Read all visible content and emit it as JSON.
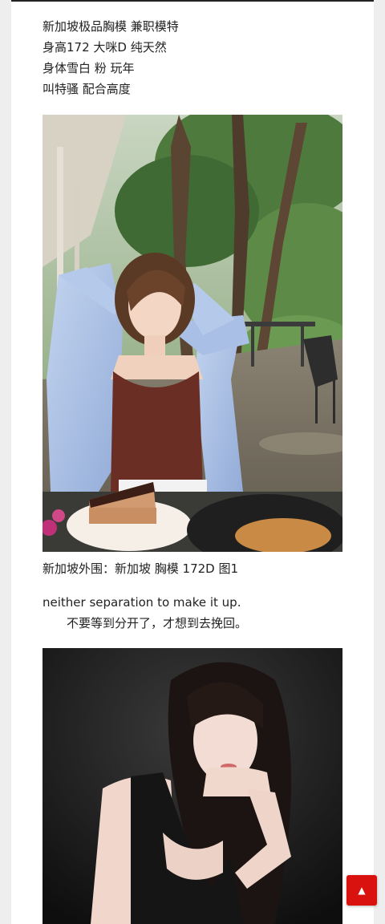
{
  "intro_lines": [
    "新加坡极品胸模 兼职模特",
    "身高172 大咪D 纯天然",
    "身体雪白 粉 玩年",
    "叫特骚 配合高度"
  ],
  "photo_1": {
    "description_icon": "photo-woman-outdoor-cafe"
  },
  "caption": "新加坡外围：新加坡 胸模 172D 图1",
  "quote": {
    "english": "neither separation to make it up.",
    "chinese": "不要等到分开了，才想到去挽回。"
  },
  "photo_2": {
    "description_icon": "photo-woman-dark-background"
  },
  "scroll_top": {
    "icon": "chevron-up-icon",
    "glyph": "▲",
    "color": "#d9120f"
  }
}
